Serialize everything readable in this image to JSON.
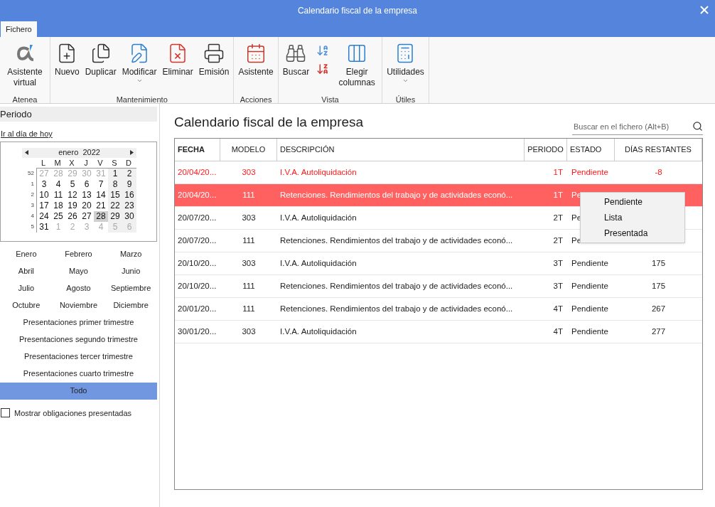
{
  "window": {
    "title": "Calendario fiscal de la empresa"
  },
  "tabs": [
    {
      "label": "Fichero",
      "selected": true
    }
  ],
  "ribbon": {
    "groups": [
      {
        "label": "Atenea",
        "buttons": [
          {
            "kind": "alpha",
            "label": "Asistente virtual",
            "dropdown": false
          }
        ]
      },
      {
        "label": "Mantenimiento",
        "buttons": [
          {
            "kind": "new",
            "label": "Nuevo",
            "dropdown": false
          },
          {
            "kind": "duplicate",
            "label": "Duplicar",
            "dropdown": false
          },
          {
            "kind": "edit",
            "label": "Modificar",
            "dropdown": true
          },
          {
            "kind": "delete",
            "label": "Eliminar",
            "dropdown": false
          },
          {
            "kind": "print",
            "label": "Emisión",
            "dropdown": false
          }
        ]
      },
      {
        "label": "Acciones",
        "buttons": [
          {
            "kind": "wizard",
            "label": "Asistente",
            "dropdown": false
          }
        ]
      },
      {
        "label": "Vista",
        "buttons": [
          {
            "kind": "search",
            "label": "Buscar",
            "dropdown": false
          },
          {
            "kind": "sort"
          },
          {
            "kind": "columns",
            "label": "Elegir columnas",
            "dropdown": false
          }
        ]
      },
      {
        "label": "Útiles",
        "buttons": [
          {
            "kind": "calculator",
            "label": "Utilidades",
            "dropdown": true
          }
        ]
      }
    ]
  },
  "sidebar": {
    "header": "Periodo",
    "today_link": "Ir al día de hoy",
    "calendar": {
      "month": "enero",
      "year": "2022",
      "weekdays": [
        "L",
        "M",
        "X",
        "J",
        "V",
        "S",
        "D"
      ],
      "weeks": [
        {
          "number": "52",
          "days": [
            {
              "d": "27",
              "muted": true,
              "selected": false
            },
            {
              "d": "28",
              "muted": true,
              "selected": false
            },
            {
              "d": "29",
              "muted": true,
              "selected": false
            },
            {
              "d": "30",
              "muted": true,
              "selected": false
            },
            {
              "d": "31",
              "muted": true,
              "selected": false
            },
            {
              "d": "1",
              "muted": false,
              "selected": false
            },
            {
              "d": "2",
              "muted": false,
              "selected": false
            }
          ]
        },
        {
          "number": "1",
          "days": [
            {
              "d": "3",
              "muted": false,
              "selected": false
            },
            {
              "d": "4",
              "muted": false,
              "selected": false
            },
            {
              "d": "5",
              "muted": false,
              "selected": false
            },
            {
              "d": "6",
              "muted": false,
              "selected": false
            },
            {
              "d": "7",
              "muted": false,
              "selected": false
            },
            {
              "d": "8",
              "muted": false,
              "selected": false
            },
            {
              "d": "9",
              "muted": false,
              "selected": false
            }
          ]
        },
        {
          "number": "2",
          "days": [
            {
              "d": "10",
              "muted": false,
              "selected": false
            },
            {
              "d": "11",
              "muted": false,
              "selected": false
            },
            {
              "d": "12",
              "muted": false,
              "selected": false
            },
            {
              "d": "13",
              "muted": false,
              "selected": false
            },
            {
              "d": "14",
              "muted": false,
              "selected": false
            },
            {
              "d": "15",
              "muted": false,
              "selected": false
            },
            {
              "d": "16",
              "muted": false,
              "selected": false
            }
          ]
        },
        {
          "number": "3",
          "days": [
            {
              "d": "17",
              "muted": false,
              "selected": false
            },
            {
              "d": "18",
              "muted": false,
              "selected": false
            },
            {
              "d": "19",
              "muted": false,
              "selected": false
            },
            {
              "d": "20",
              "muted": false,
              "selected": false
            },
            {
              "d": "21",
              "muted": false,
              "selected": false
            },
            {
              "d": "22",
              "muted": false,
              "selected": false
            },
            {
              "d": "23",
              "muted": false,
              "selected": false
            }
          ]
        },
        {
          "number": "4",
          "days": [
            {
              "d": "24",
              "muted": false,
              "selected": false
            },
            {
              "d": "25",
              "muted": false,
              "selected": false
            },
            {
              "d": "26",
              "muted": false,
              "selected": false
            },
            {
              "d": "27",
              "muted": false,
              "selected": false
            },
            {
              "d": "28",
              "muted": false,
              "selected": true
            },
            {
              "d": "29",
              "muted": false,
              "selected": false
            },
            {
              "d": "30",
              "muted": false,
              "selected": false
            }
          ]
        },
        {
          "number": "5",
          "days": [
            {
              "d": "31",
              "muted": false,
              "selected": false
            },
            {
              "d": "1",
              "muted": true,
              "selected": false
            },
            {
              "d": "2",
              "muted": true,
              "selected": false
            },
            {
              "d": "3",
              "muted": true,
              "selected": false
            },
            {
              "d": "4",
              "muted": true,
              "selected": false
            },
            {
              "d": "5",
              "muted": true,
              "selected": false
            },
            {
              "d": "6",
              "muted": true,
              "selected": false
            }
          ]
        }
      ]
    },
    "periods": [
      {
        "kind": "month",
        "label": "Enero",
        "selected": false
      },
      {
        "kind": "month",
        "label": "Febrero",
        "selected": false
      },
      {
        "kind": "month",
        "label": "Marzo",
        "selected": false
      },
      {
        "kind": "month",
        "label": "Abril",
        "selected": false
      },
      {
        "kind": "month",
        "label": "Mayo",
        "selected": false
      },
      {
        "kind": "month",
        "label": "Junio",
        "selected": false
      },
      {
        "kind": "month",
        "label": "Julio",
        "selected": false
      },
      {
        "kind": "month",
        "label": "Agosto",
        "selected": false
      },
      {
        "kind": "month",
        "label": "Septiembre",
        "selected": false
      },
      {
        "kind": "month",
        "label": "Octubre",
        "selected": false
      },
      {
        "kind": "month",
        "label": "Noviembre",
        "selected": false
      },
      {
        "kind": "month",
        "label": "Diciembre",
        "selected": false
      },
      {
        "kind": "wide",
        "label": "Presentaciones primer trimestre",
        "selected": false
      },
      {
        "kind": "wide",
        "label": "Presentaciones segundo trimestre",
        "selected": false
      },
      {
        "kind": "wide",
        "label": "Presentaciones tercer trimestre",
        "selected": false
      },
      {
        "kind": "wide",
        "label": "Presentaciones cuarto trimestre",
        "selected": false
      },
      {
        "kind": "wide",
        "label": "Todo",
        "selected": true
      }
    ],
    "show_filed": {
      "label": "Mostrar obligaciones presentadas",
      "checked": false
    }
  },
  "main": {
    "title": "Calendario fiscal de la empresa",
    "search": {
      "placeholder": "Buscar en el fichero (Alt+B)"
    },
    "table": {
      "columns": [
        "FECHA",
        "MODELO",
        "DESCRIPCIÓN",
        "PERIODO",
        "ESTADO",
        "DÍAS RESTANTES"
      ],
      "rows": [
        {
          "cells": [
            "20/04/20...",
            "303",
            "I.V.A. Autoliquidación",
            "1T",
            "Pendiente",
            "-8"
          ],
          "overdue": true,
          "selected": false
        },
        {
          "cells": [
            "20/04/20...",
            "111",
            "Retenciones. Rendimientos del trabajo y de actividades econó...",
            "1T",
            "Pe"
          ],
          "overdue": true,
          "selected": true
        },
        {
          "cells": [
            "20/07/20...",
            "303",
            "I.V.A. Autoliquidación",
            "2T",
            "Pe"
          ],
          "overdue": false,
          "selected": false
        },
        {
          "cells": [
            "20/07/20...",
            "111",
            "Retenciones. Rendimientos del trabajo y de actividades econó...",
            "2T",
            "Pe"
          ],
          "overdue": false,
          "selected": false
        },
        {
          "cells": [
            "20/10/20...",
            "303",
            "I.V.A. Autoliquidación",
            "3T",
            "Pendiente",
            "175"
          ],
          "overdue": false,
          "selected": false
        },
        {
          "cells": [
            "20/10/20...",
            "111",
            "Retenciones. Rendimientos del trabajo y de actividades econó...",
            "3T",
            "Pendiente",
            "175"
          ],
          "overdue": false,
          "selected": false
        },
        {
          "cells": [
            "20/01/20...",
            "111",
            "Retenciones. Rendimientos del trabajo y de actividades econó...",
            "4T",
            "Pendiente",
            "267"
          ],
          "overdue": false,
          "selected": false
        },
        {
          "cells": [
            "30/01/20...",
            "303",
            "I.V.A. Autoliquidación",
            "4T",
            "Pendiente",
            "277"
          ],
          "overdue": false,
          "selected": false
        }
      ]
    },
    "context_menu": {
      "items": [
        "Pendiente",
        "Lista",
        "Presentada"
      ]
    }
  }
}
